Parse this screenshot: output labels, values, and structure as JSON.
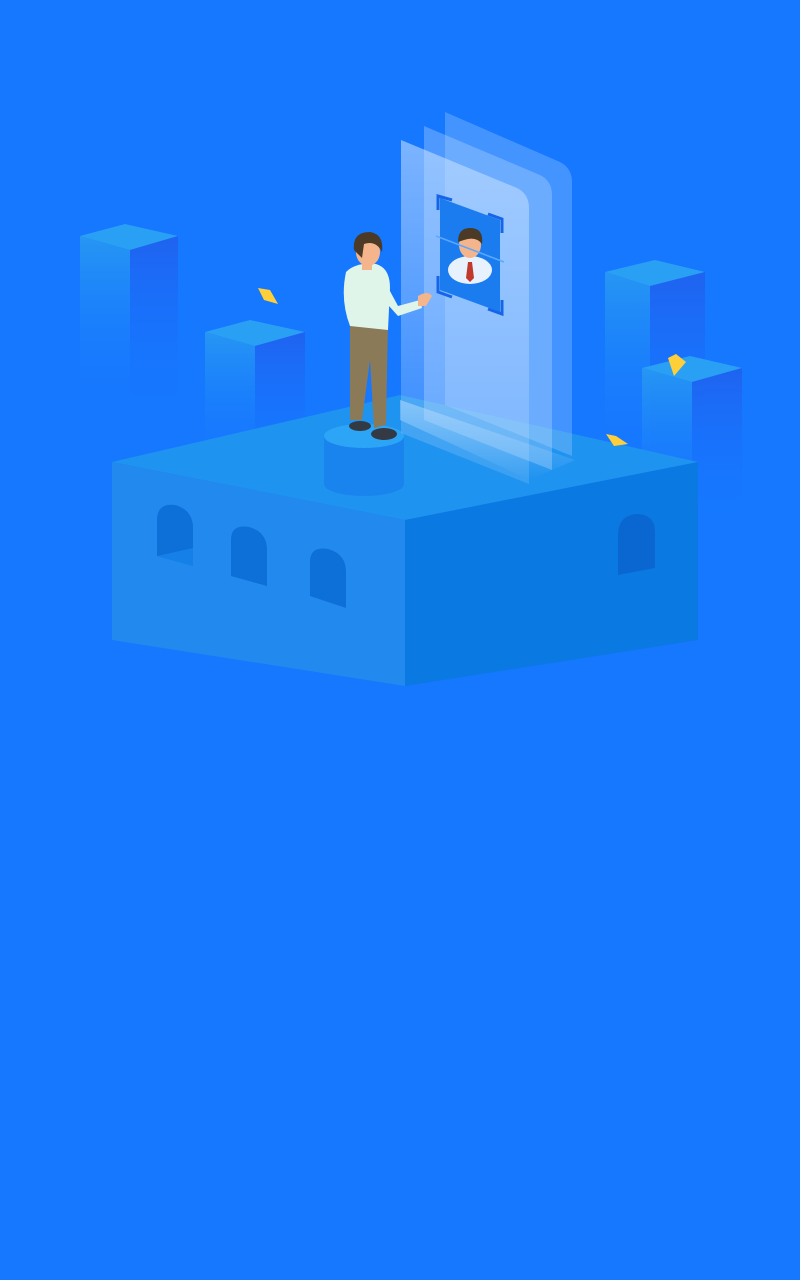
{
  "screen": {
    "background_color": "#1677ff"
  },
  "illustration": {
    "description_icon": "face-recognition-scene-icon",
    "colors": {
      "platform_top": "#1a8af0",
      "platform_front": "#1f86ee",
      "platform_side": "#0a7ae0",
      "tower_light": "#2394f2",
      "tower_dark": "#1f6cf0",
      "panel": "#a9d3ff",
      "accent_yellow": "#ffcf3a",
      "shirt": "#dff5ea",
      "pants": "#8a7a58",
      "hair": "#4a3a26",
      "skin": "#f4b58c"
    }
  }
}
